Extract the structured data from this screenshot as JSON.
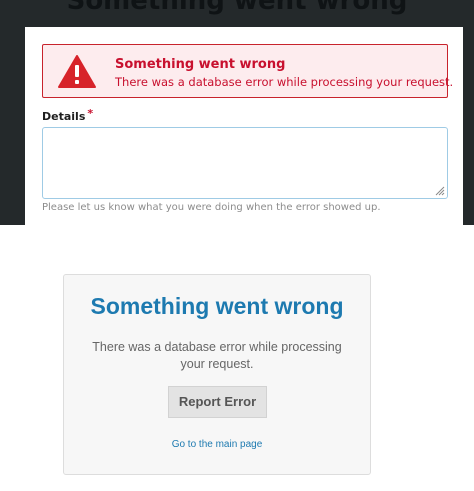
{
  "background_page": {
    "title": "Something went wrong"
  },
  "modal": {
    "alert": {
      "icon": "warning-triangle-icon",
      "title": "Something went wrong",
      "message": "There was a database error while processing your request."
    },
    "details": {
      "label": "Details",
      "required_marker": "*",
      "value": "",
      "helper_text": "Please let us know what you were doing when the error showed up."
    }
  },
  "card": {
    "title": "Something went wrong",
    "message": "There was a database error while processing your request.",
    "report_button_label": "Report Error",
    "main_page_link": "Go to the main page"
  },
  "colors": {
    "error_red": "#c8102e",
    "alert_bg": "#fdecee",
    "link_blue": "#1d7ab0",
    "dark_bg": "#24292b"
  }
}
